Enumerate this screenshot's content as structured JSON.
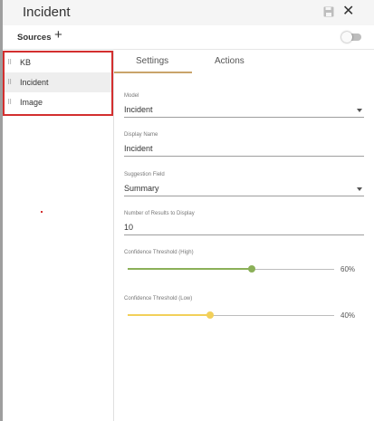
{
  "window": {
    "title": "Incident"
  },
  "sources": {
    "label": "Sources",
    "items": [
      {
        "label": "KB",
        "selected": false
      },
      {
        "label": "Incident",
        "selected": true
      },
      {
        "label": "Image",
        "selected": false
      }
    ]
  },
  "tabs": [
    {
      "label": "Settings",
      "active": true
    },
    {
      "label": "Actions",
      "active": false
    }
  ],
  "form": {
    "model": {
      "label": "Model",
      "value": "Incident"
    },
    "display_name": {
      "label": "Display Name",
      "value": "Incident"
    },
    "suggestion_field": {
      "label": "Suggestion Field",
      "value": "Summary"
    },
    "num_results": {
      "label": "Number of Results to Display",
      "value": "10"
    },
    "threshold_high": {
      "label": "Confidence Threshold (High)",
      "value": 60,
      "display": "60%",
      "color": "#8bb058"
    },
    "threshold_low": {
      "label": "Confidence Threshold (Low)",
      "value": 40,
      "display": "40%",
      "color": "#f2d05a"
    }
  },
  "colors": {
    "selection_border": "#d32f2f",
    "tab_underline": "#c9a46a"
  }
}
